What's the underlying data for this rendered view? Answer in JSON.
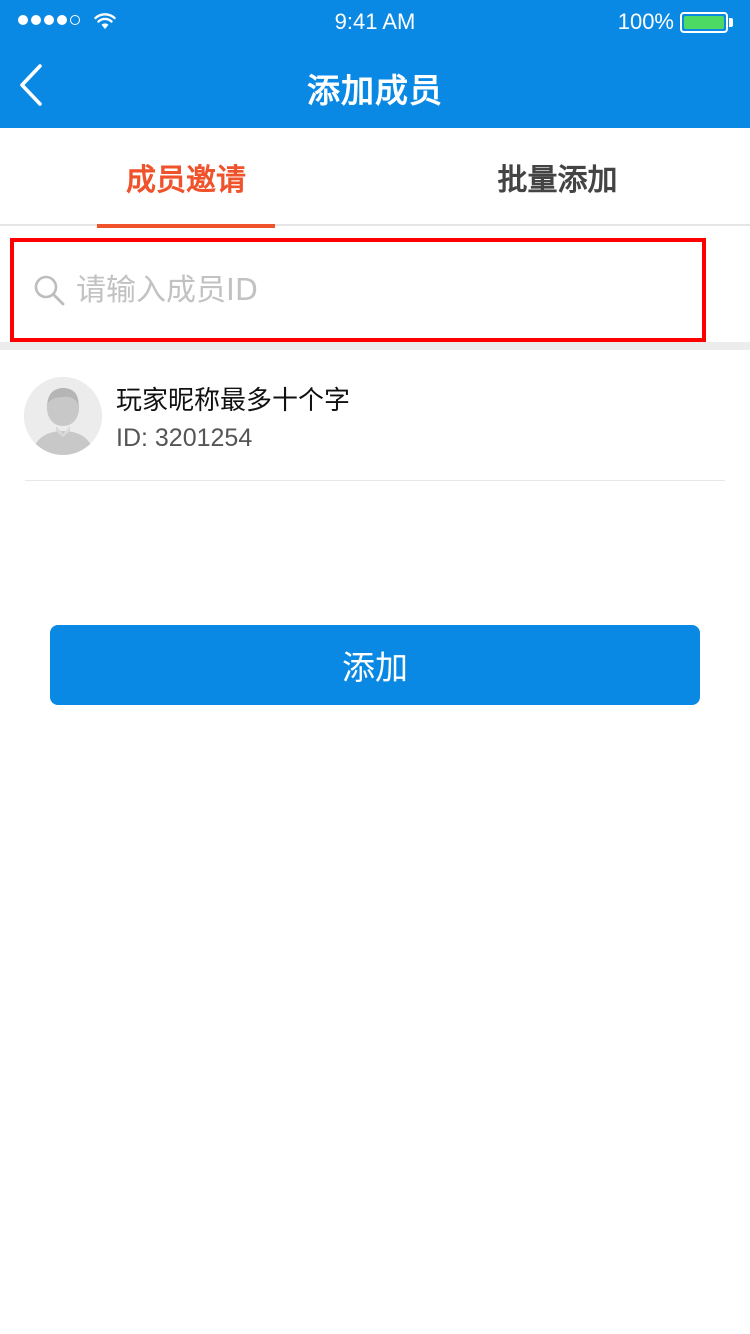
{
  "status_bar": {
    "time": "9:41 AM",
    "battery_percent": "100%",
    "signal_strength": 4,
    "battery_color": "#4cd964"
  },
  "nav": {
    "title": "添加成员",
    "back_icon": "chevron-left-icon"
  },
  "tabs": [
    {
      "label": "成员邀请",
      "active": true
    },
    {
      "label": "批量添加",
      "active": false
    }
  ],
  "search": {
    "placeholder": "请输入成员ID",
    "value": "",
    "icon": "search-icon"
  },
  "member": {
    "name": "玩家昵称最多十个字",
    "id_text": "ID: 3201254",
    "avatar_icon": "user-avatar-icon"
  },
  "actions": {
    "add_label": "添加"
  },
  "colors": {
    "primary": "#0a89e4",
    "accent": "#f0522b",
    "highlight_border": "#ff0000"
  }
}
